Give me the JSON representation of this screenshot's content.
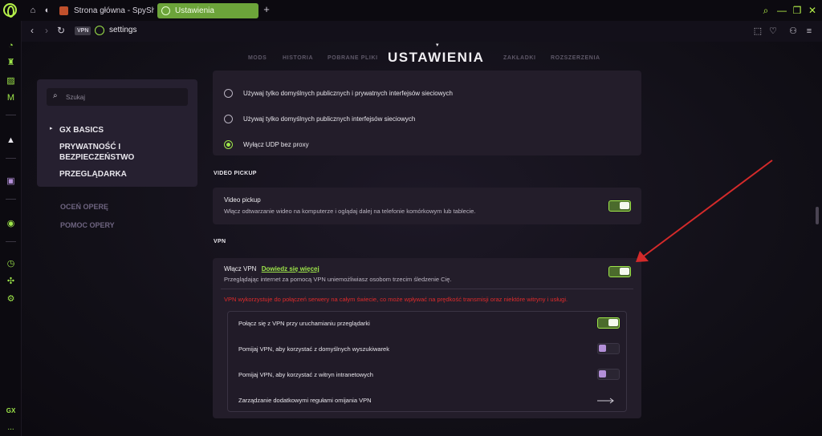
{
  "tabs": [
    {
      "label": "Strona główna - SpyShop"
    },
    {
      "label": "Ustawienia"
    }
  ],
  "address": {
    "badge": "VPN",
    "url": "settings"
  },
  "top_nav": [
    "MODS",
    "HISTORIA",
    "POBRANE PLIKI",
    "ZAKŁADKI",
    "ROZSZERZENIA"
  ],
  "page_title": "USTAWIENIA",
  "left_menu": {
    "search_placeholder": "Szukaj",
    "items": [
      "GX BASICS",
      "PRYWATNOŚĆ I BEZPIECZEŃSTWO",
      "PRZEGLĄDARKA"
    ],
    "items_wrapped": [
      "PRYWATNOŚĆ I",
      "BEZPIECZEŃSTWO"
    ],
    "links": [
      "OCEŃ OPERĘ",
      "POMOC OPERY"
    ]
  },
  "webrtc_options": [
    {
      "label": "Używaj tylko domyślnych publicznych i prywatnych interfejsów sieciowych",
      "selected": false
    },
    {
      "label": "Używaj tylko domyślnych publicznych interfejsów sieciowych",
      "selected": false
    },
    {
      "label": "Wyłącz UDP bez proxy",
      "selected": true
    }
  ],
  "video_pickup": {
    "section_heading": "VIDEO PICKUP",
    "title": "Video pickup",
    "description": "Włącz odtwarzanie wideo na komputerze i oglądaj dalej na telefonie komórkowym lub tablecie.",
    "enabled": true
  },
  "vpn": {
    "section_heading": "VPN",
    "title": "Włącz VPN",
    "learn_more": "Dowiedz się więcej",
    "description": "Przeglądając internet za pomocą VPN uniemożliwiasz osobom trzecim śledzenie Cię.",
    "enabled": true,
    "warning": "VPN wykorzystuje do połączeń serwery na całym świecie, co może wpływać na prędkość transmisji oraz niektóre witryny i usługi.",
    "options": [
      {
        "label": "Połącz się z VPN przy uruchamianiu przeglądarki",
        "enabled": true
      },
      {
        "label": "Pomijaj VPN, aby korzystać z domyślnych wyszukiwarek",
        "enabled": false
      },
      {
        "label": "Pomijaj VPN, aby korzystać z witryn intranetowych",
        "enabled": false
      }
    ],
    "manage_rules": "Zarządzanie dodatkowymi regułami omijania VPN"
  },
  "sidebar": {
    "gx_label": "GX",
    "more_label": "..."
  },
  "colors": {
    "accent": "#9ee64a",
    "warning": "#e02b2b",
    "annotation_arrow": "#d42a2a"
  }
}
